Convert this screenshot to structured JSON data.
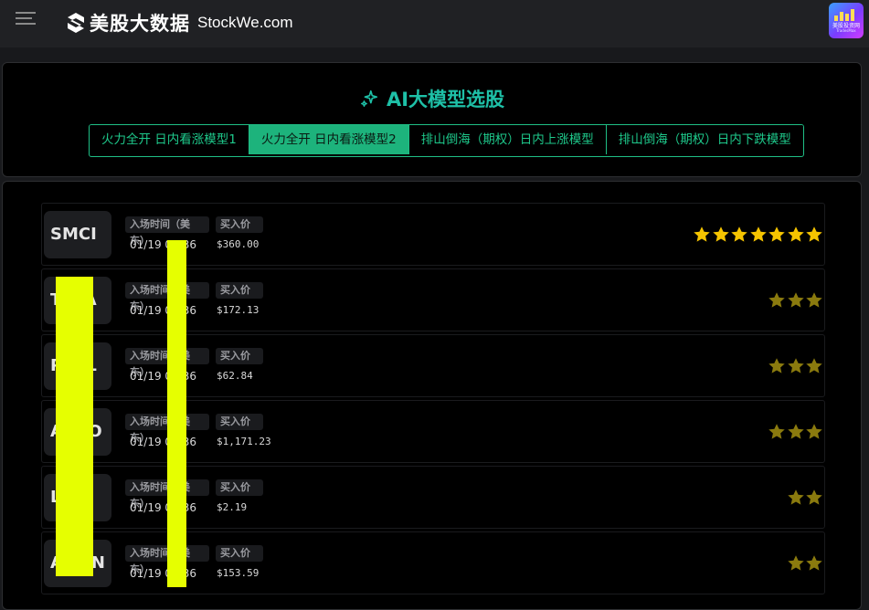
{
  "header": {
    "logo_cn": "美股大数据",
    "logo_en": "StockWe.com",
    "app_badge_title": "美股投资网",
    "app_badge_sub": "TradesMax"
  },
  "panel": {
    "title": "AI大模型选股",
    "tabs": [
      {
        "label": "火力全开 日内看涨模型1",
        "active": false
      },
      {
        "label": "火力全开 日内看涨模型2",
        "active": true
      },
      {
        "label": "排山倒海（期权）日内上涨模型",
        "active": false
      },
      {
        "label": "排山倒海（期权）日内下跌模型",
        "active": false
      }
    ]
  },
  "labels": {
    "entry_time": "入场时间（美东）",
    "buy_price": "买入价"
  },
  "picks": [
    {
      "ticker": "SMCI",
      "time": "01/19 09:36",
      "price": "$360.00",
      "stars": 7,
      "star_color": "#f5c400"
    },
    {
      "ticker": "TSLA",
      "time": "01/19 09:36",
      "price": "$172.13",
      "stars": 3,
      "star_color": "#8a7a0e"
    },
    {
      "ticker": "PYPL",
      "time": "01/19 09:36",
      "price": "$62.84",
      "stars": 3,
      "star_color": "#8a7a0e"
    },
    {
      "ticker": "AVGO",
      "time": "01/19 09:36",
      "price": "$1,171.23",
      "stars": 3,
      "star_color": "#8a7a0e"
    },
    {
      "ticker": "LU",
      "time": "01/19 09:36",
      "price": "$2.19",
      "stars": 2,
      "star_color": "#8a7a0e"
    },
    {
      "ticker": "AMZN",
      "time": "01/19 09:36",
      "price": "$153.59",
      "stars": 2,
      "star_color": "#8a7a0e"
    }
  ],
  "colors": {
    "accent": "#1ec0a7",
    "tab_active_bg": "#1db37c",
    "star_bright": "#f5c400",
    "star_dim": "#8a7a0e",
    "redaction": "#e6ff00"
  }
}
